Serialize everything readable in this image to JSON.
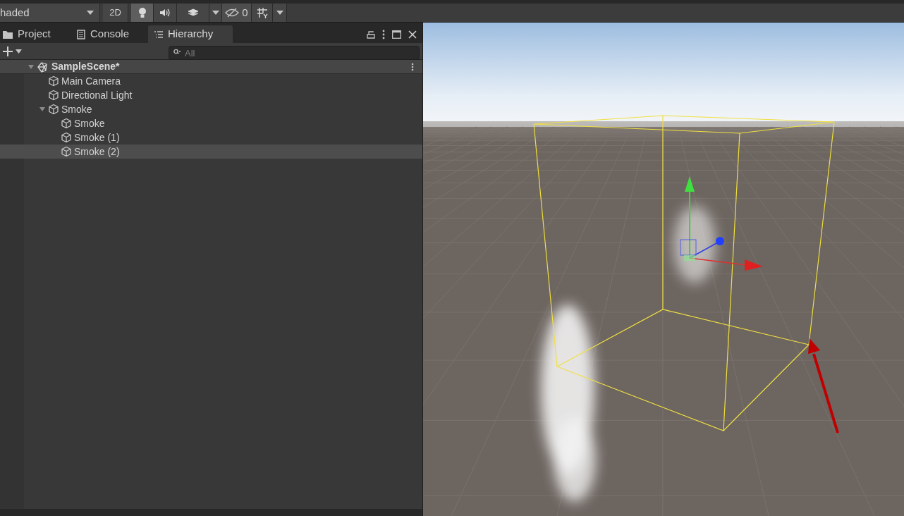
{
  "toolbar": {
    "draw_mode": "haded",
    "mode_2d": "2D",
    "lighting_on": true,
    "hidden_count": "0"
  },
  "tabs": [
    {
      "label": "Project",
      "kind": "folder",
      "selected": false
    },
    {
      "label": "Console",
      "kind": "console",
      "selected": false
    },
    {
      "label": "Hierarchy",
      "kind": "list",
      "selected": true
    }
  ],
  "search": {
    "placeholder": "All"
  },
  "hierarchy": {
    "scene": "SampleScene*",
    "expanded": true,
    "children": [
      {
        "name": "Main Camera",
        "selected": false
      },
      {
        "name": "Directional Light",
        "selected": false
      },
      {
        "name": "Smoke",
        "selected": false,
        "expanded": true,
        "children": [
          {
            "name": "Smoke",
            "selected": false
          },
          {
            "name": "Smoke (1)",
            "selected": false
          },
          {
            "name": "Smoke (2)",
            "selected": true
          }
        ]
      }
    ]
  }
}
